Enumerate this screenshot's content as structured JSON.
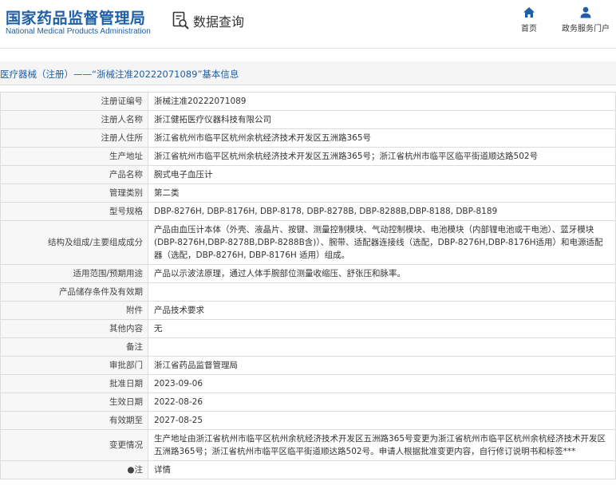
{
  "header": {
    "logo_cn": "国家药品监督管理局",
    "logo_en": "National Medical Products Administration",
    "query_icon": "search-document-icon",
    "query_label": "数据查询",
    "nav": [
      {
        "label": "首页",
        "icon": "home-icon"
      },
      {
        "label": "政务服务门户",
        "icon": "user-icon"
      }
    ]
  },
  "breadcrumb": "医疗器械（注册）——“浙械注准20222071089”基本信息",
  "colors": {
    "brand_blue": "#1f5fa8",
    "label_bg": "#f7f7f7",
    "border": "#dcdcdc"
  },
  "rows": [
    {
      "label": "注册证编号",
      "value": "浙械注准20222071089"
    },
    {
      "label": "注册人名称",
      "value": "浙江健拓医疗仪器科技有限公司"
    },
    {
      "label": "注册人住所",
      "value": "浙江省杭州市临平区杭州余杭经济技术开发区五洲路365号"
    },
    {
      "label": "生产地址",
      "value": "浙江省杭州市临平区杭州余杭经济技术开发区五洲路365号；浙江省杭州市临平区临平街道顺达路502号"
    },
    {
      "label": "产品名称",
      "value": "腕式电子血压计"
    },
    {
      "label": "管理类别",
      "value": "第二类"
    },
    {
      "label": "型号规格",
      "value": "DBP-8276H, DBP-8176H, DBP-8178, DBP-8278B, DBP-8288B,DBP-8188, DBP-8189"
    },
    {
      "label": "结构及组成/主要组成成分",
      "value": "产品由血压计本体（外壳、液晶片、按键、测量控制模块、气动控制模块、电池模块（内部锂电池或干电池）、蓝牙模块(DBP-8276H,DBP-8278B,DBP-8288B含)）、腕带、适配器连接线（选配，DBP-8276H,DBP-8176H适用）和电源适配器（选配，DBP-8276H, DBP-8176H 适用）组成。"
    },
    {
      "label": "适用范围/预期用途",
      "value": "产品以示波法原理，通过人体手腕部位测量收缩压、舒张压和脉率。"
    },
    {
      "label": "产品储存条件及有效期",
      "value": ""
    },
    {
      "label": "附件",
      "value": "产品技术要求"
    },
    {
      "label": "其他内容",
      "value": "无"
    },
    {
      "label": "备注",
      "value": ""
    },
    {
      "label": "审批部门",
      "value": "浙江省药品监督管理局"
    },
    {
      "label": "批准日期",
      "value": "2023-09-06"
    },
    {
      "label": "生效日期",
      "value": "2022-08-26"
    },
    {
      "label": "有效期至",
      "value": "2027-08-25"
    },
    {
      "label": "变更情况",
      "value": "生产地址由浙江省杭州市临平区杭州余杭经济技术开发区五洲路365号变更为浙江省杭州市临平区杭州余杭经济技术开发区五洲路365号；浙江省杭州市临平区临平街道顺达路502号。申请人根据批准变更内容，自行修订说明书和标签***"
    },
    {
      "label": "●注",
      "value": "详情"
    }
  ]
}
